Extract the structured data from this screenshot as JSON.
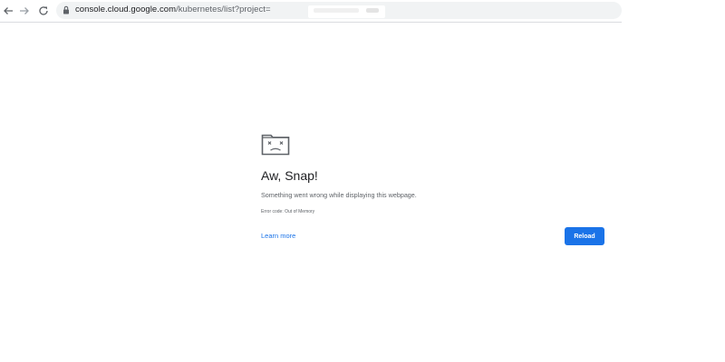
{
  "toolbar": {
    "url_host": "console.cloud.google.com",
    "url_path": "/kubernetes/list?project=",
    "back_icon": "back-arrow-icon",
    "forward_icon": "forward-arrow-icon",
    "reload_icon": "reload-icon",
    "lock_icon": "lock-icon"
  },
  "error_page": {
    "icon": "sad-tab-icon",
    "title": "Aw, Snap!",
    "message": "Something went wrong while displaying this webpage.",
    "error_code": "Error code: Out of Memory",
    "learn_more_label": "Learn more",
    "reload_label": "Reload"
  },
  "colors": {
    "accent": "#1a73e8",
    "text_primary": "#202124",
    "text_secondary": "#5f6368",
    "omnibox_bg": "#f1f3f4"
  }
}
